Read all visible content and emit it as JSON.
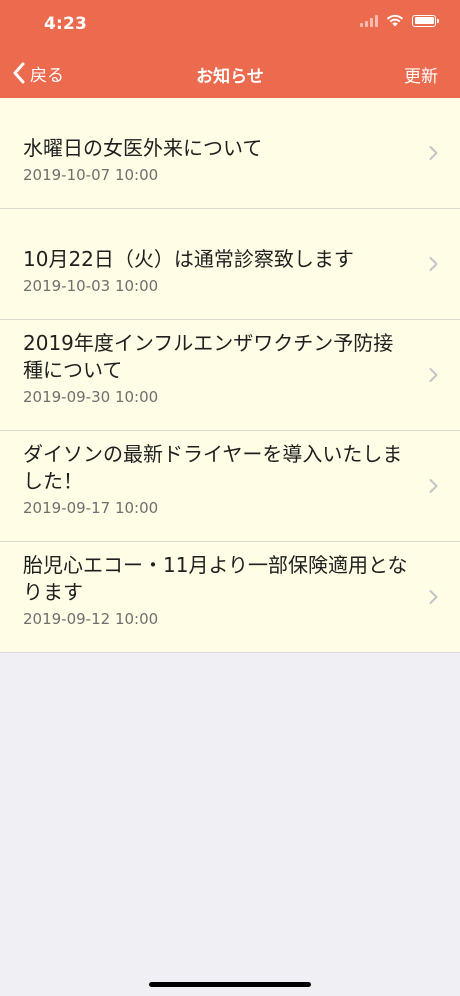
{
  "status_bar": {
    "time": "4:23"
  },
  "nav": {
    "back_label": "戻る",
    "title": "お知らせ",
    "refresh_label": "更新"
  },
  "colors": {
    "header": "#ec6b4e",
    "list_background": "#fffde6",
    "page_background": "#efeff4"
  },
  "news": [
    {
      "title": "水曜日の女医外来について",
      "date": "2019-10-07 10:00"
    },
    {
      "title": "10月22日（火）は通常診察致します",
      "date": "2019-10-03 10:00"
    },
    {
      "title": "2019年度インフルエンザワクチン予防接種について",
      "date": "2019-09-30 10:00"
    },
    {
      "title": "ダイソンの最新ドライヤーを導入いたしました！",
      "date": "2019-09-17 10:00"
    },
    {
      "title": "胎児心エコー・11月より一部保険適用となります",
      "date": "2019-09-12 10:00"
    }
  ]
}
